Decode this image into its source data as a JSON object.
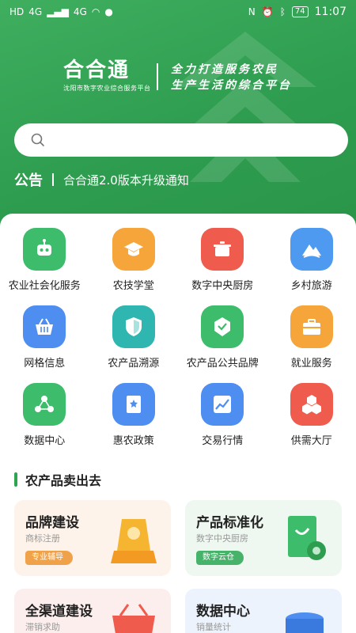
{
  "status_bar": {
    "left": [
      "HD",
      "4G",
      "4G"
    ],
    "battery": "74",
    "time": "11:07"
  },
  "brand": {
    "title": "合合通",
    "subtitle": "沈阳市数字农业综合服务平台",
    "slogan_line1": "全力打造服务农民",
    "slogan_line2": "生产生活的综合平台"
  },
  "search": {
    "placeholder": ""
  },
  "notice": {
    "tag": "公告",
    "text": "合合通2.0版本升级通知"
  },
  "grid": [
    [
      {
        "label": "农业社会化服务",
        "icon": "robot-icon",
        "color": "#3dbd6b"
      },
      {
        "label": "农技学堂",
        "icon": "graduation-cap-icon",
        "color": "#f5a53a"
      },
      {
        "label": "数字中央厨房",
        "icon": "pot-icon",
        "color": "#ef5b4c"
      },
      {
        "label": "乡村旅游",
        "icon": "mountain-icon",
        "color": "#4d9af0"
      }
    ],
    [
      {
        "label": "网格信息",
        "icon": "basket-icon",
        "color": "#4d8ef0"
      },
      {
        "label": "农产品溯源",
        "icon": "shield-icon",
        "color": "#2fb6b0"
      },
      {
        "label": "农产品公共品牌",
        "icon": "badge-icon",
        "color": "#3dbd6b"
      },
      {
        "label": "就业服务",
        "icon": "briefcase-icon",
        "color": "#f5a53a"
      }
    ],
    [
      {
        "label": "数据中心",
        "icon": "share-nodes-icon",
        "color": "#3dbd6b"
      },
      {
        "label": "惠农政策",
        "icon": "policy-book-icon",
        "color": "#4d8ef0"
      },
      {
        "label": "交易行情",
        "icon": "trend-chart-icon",
        "color": "#4d8ef0"
      },
      {
        "label": "供需大厅",
        "icon": "hexagon-cluster-icon",
        "color": "#ef5b4c"
      }
    ]
  ],
  "section": {
    "title": "农产品卖出去"
  },
  "cards": [
    {
      "title": "品牌建设",
      "sub": "商标注册",
      "badge": "专业辅导",
      "bg": "#fdf3ea",
      "badge_color": "#f0a24a",
      "art": "trophy-icon"
    },
    {
      "title": "产品标准化",
      "sub": "数字中央厨房",
      "badge": "数字云仓",
      "bg": "#eef8f0",
      "badge_color": "#47b36a",
      "art": "certificate-icon"
    },
    {
      "title": "全渠道建设",
      "sub": "滞销求助",
      "badge": "",
      "bg": "#fdeeee",
      "badge_color": "#ef5b4c",
      "art": "basket-icon"
    },
    {
      "title": "数据中心",
      "sub": "销量统计",
      "badge": "",
      "bg": "#edf3fc",
      "badge_color": "#4d8ef0",
      "art": "database-icon"
    }
  ]
}
